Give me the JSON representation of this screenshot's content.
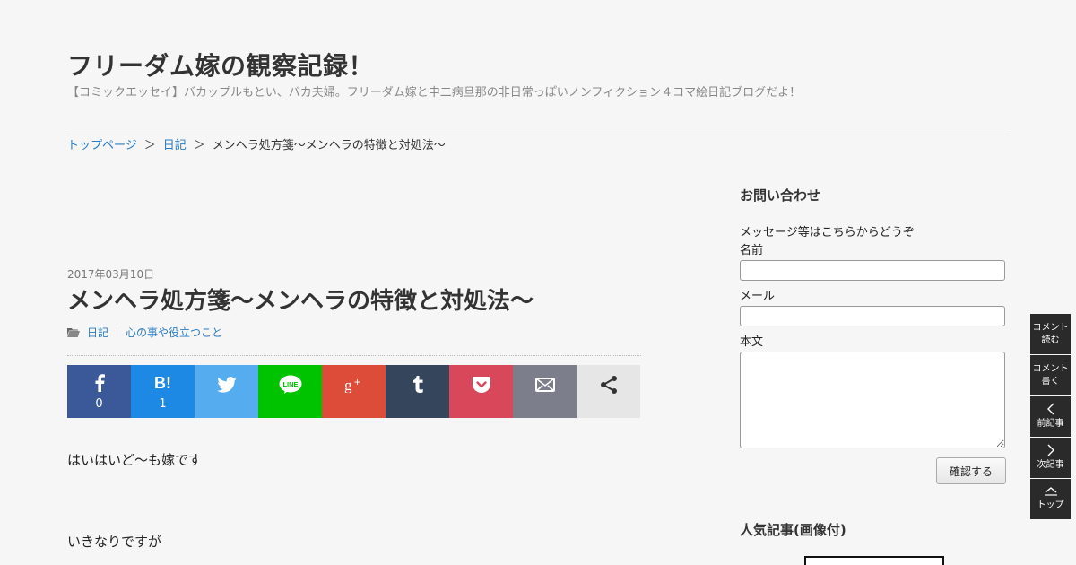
{
  "header": {
    "title": "フリーダム嫁の観察記録！",
    "description": "【コミックエッセイ】バカップルもとい、バカ夫婦。フリーダム嫁と中二病旦那の非日常っぽいノンフィクション４コマ絵日記ブログだよ！"
  },
  "breadcrumb": {
    "home": "トップページ",
    "sep1": "＞",
    "category": "日記",
    "sep2": "＞",
    "current": "メンヘラ処方箋～メンヘラの特徴と対処法～"
  },
  "post": {
    "date": "2017年03月10日",
    "title": "メンヘラ処方箋～メンヘラの特徴と対処法～",
    "categories": [
      "日記",
      "心の事や役立つこと"
    ],
    "paragraphs": [
      "はいはいど～も嫁です",
      "いきなりですが"
    ]
  },
  "share": {
    "facebook_count": "0",
    "hatena_label": "B!",
    "hatena_count": "1",
    "line_label": "LINE"
  },
  "sidebar": {
    "contact_title": "お問い合わせ",
    "contact_intro": "メッセージ等はこちらからどうぞ",
    "name_label": "名前",
    "mail_label": "メール",
    "body_label": "本文",
    "confirm_label": "確認する",
    "popular_title": "人気記事(画像付)"
  },
  "float_nav": {
    "read_comments": [
      "コメント",
      "読む"
    ],
    "write_comment": [
      "コメント",
      "書く"
    ],
    "prev": "前記事",
    "next": "次記事",
    "top": "トップ"
  },
  "colors": {
    "facebook": "#3b5998",
    "hatena": "#1e88e5",
    "twitter": "#55acee",
    "line": "#00c300",
    "googleplus": "#dd4b39",
    "tumblr": "#35465c",
    "pocket": "#d9475a",
    "mail": "#7c7e8c",
    "link": "#2a7bc4"
  }
}
